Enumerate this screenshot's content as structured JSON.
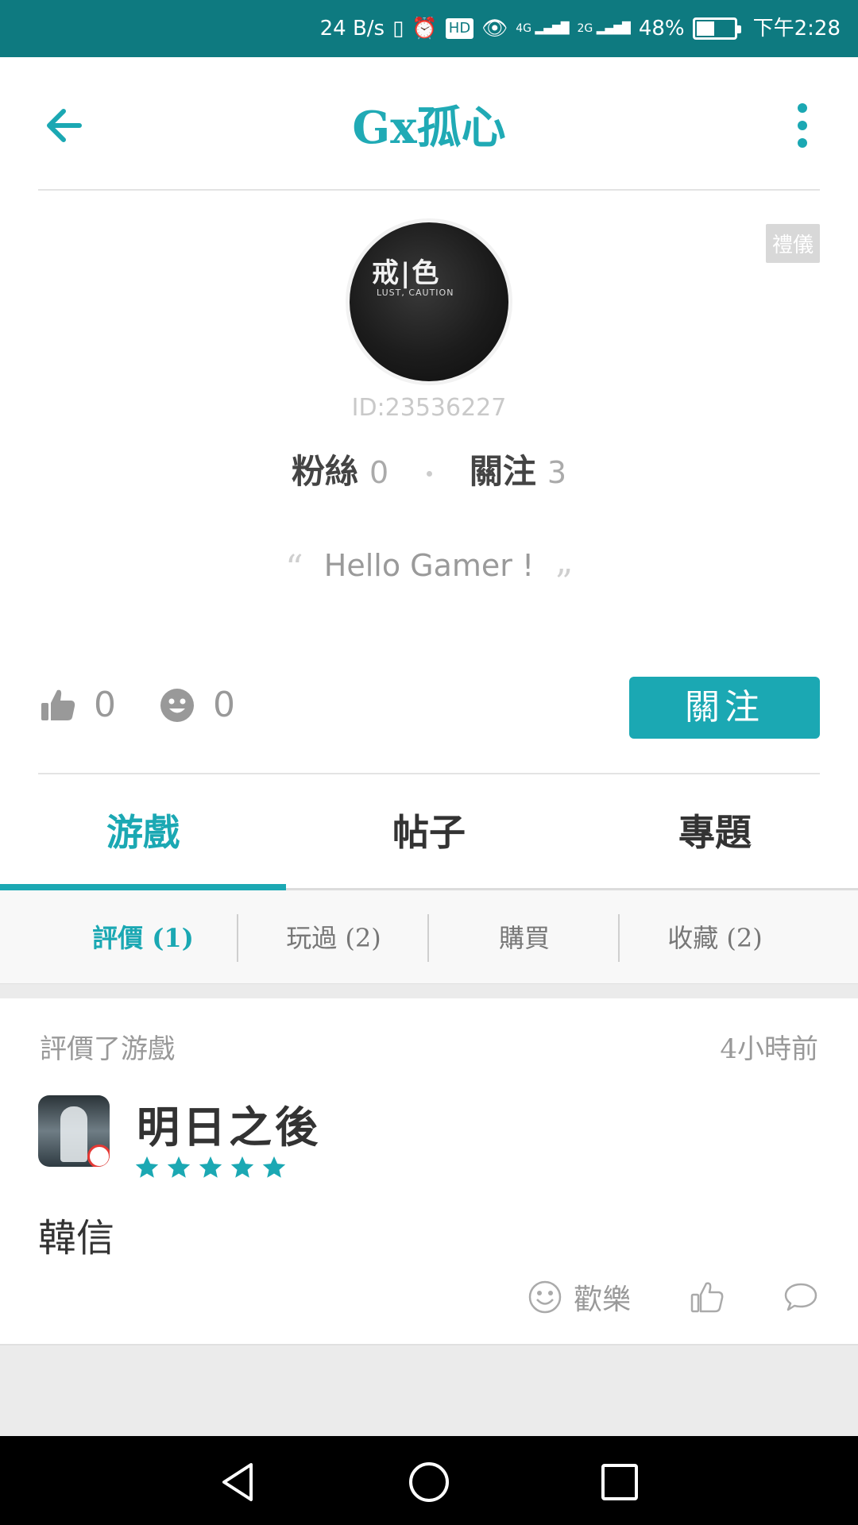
{
  "status_bar": {
    "net_speed": "24 B/s",
    "network_4g": "4G",
    "network_2g": "2G",
    "battery": "48%",
    "battery_level": 0.48,
    "time": "下午2:28",
    "hd_label": "HD"
  },
  "header": {
    "title": "Gx孤心",
    "back_icon": "arrow-left-icon",
    "more_icon": "more-vertical-icon"
  },
  "profile": {
    "tag": "禮儀",
    "avatar_text": "戒|色",
    "avatar_subtext": "LUST, CAUTION",
    "id": "ID:23536227",
    "fans_label": "粉絲",
    "fans_count": "0",
    "follow_label": "關注",
    "follow_count": "3",
    "quote_open": "“",
    "quote": "Hello Gamer !",
    "quote_close": "”",
    "likes": "0",
    "smiles": "0",
    "follow_button": "關注"
  },
  "tabs": [
    {
      "label": "游戲",
      "active": true
    },
    {
      "label": "帖子",
      "active": false
    },
    {
      "label": "專題",
      "active": false
    }
  ],
  "subtabs": [
    {
      "label": "評價 (1)",
      "active": true
    },
    {
      "label": "玩過 (2)",
      "active": false
    },
    {
      "label": "購買",
      "active": false
    },
    {
      "label": "收藏 (2)",
      "active": false
    }
  ],
  "review": {
    "meta": "評價了游戲",
    "time": "4小時前",
    "game_name": "明日之後",
    "rating": 5,
    "rating_max": 5,
    "text": "韓信",
    "reaction_label": "歡樂"
  },
  "colors": {
    "accent": "#1ba8b3",
    "status_bar": "#0e7a80"
  }
}
